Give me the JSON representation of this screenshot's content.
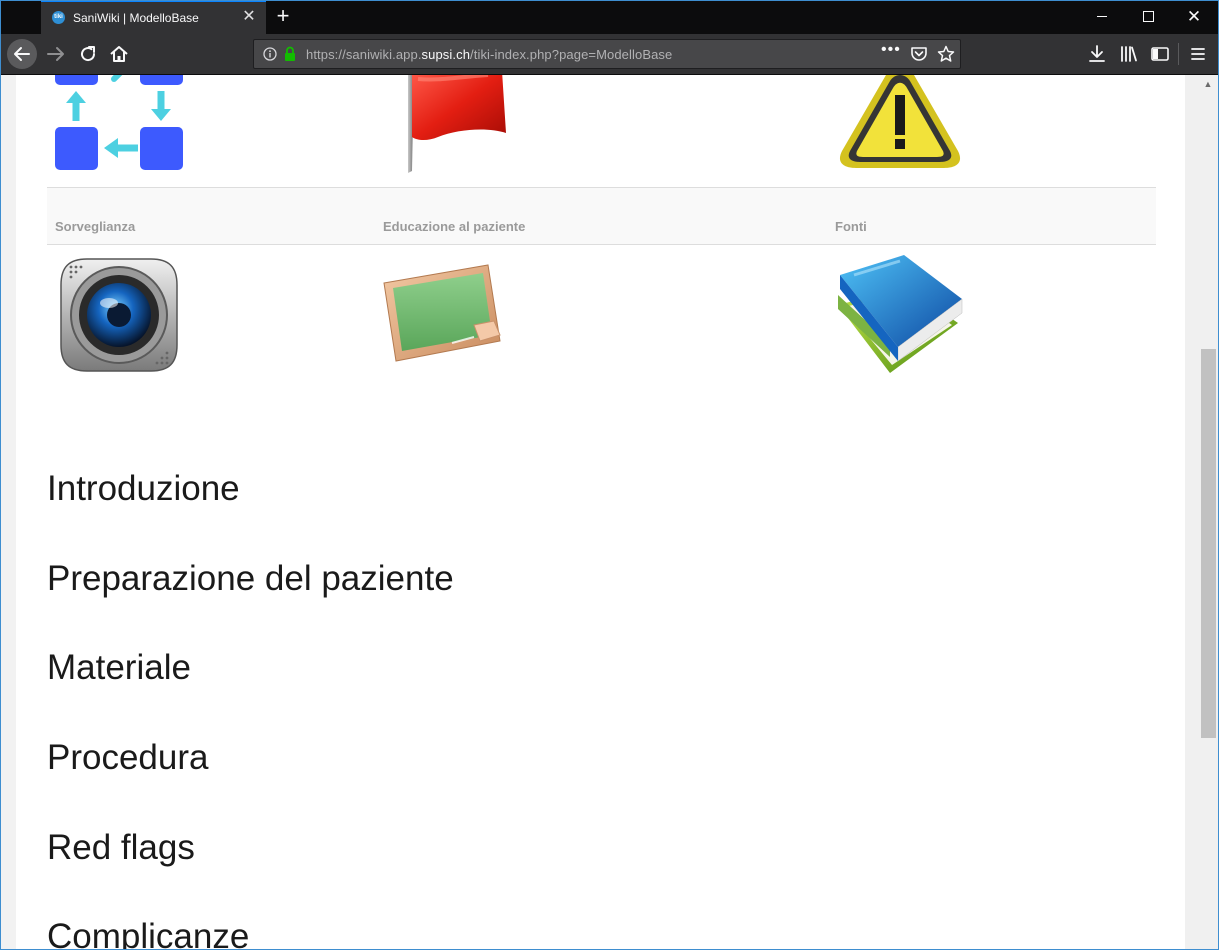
{
  "browser": {
    "tab_title": "SaniWiki | ModelloBase",
    "tab_favicon_text": "tiki",
    "url_prefix": "https://saniwiki.app.",
    "url_host": "supsi.ch",
    "url_path": "/tiki-index.php?page=ModelloBase",
    "url_more": "•••",
    "accent_color": "#0a84ff",
    "icons": {
      "tab_close": "close-icon",
      "new_tab": "plus-icon",
      "back": "arrow-left-icon",
      "forward": "arrow-right-icon",
      "reload": "reload-icon",
      "home": "home-icon",
      "site_info": "info-icon",
      "secure": "lock-icon",
      "pocket": "pocket-icon",
      "bookmark": "star-icon",
      "downloads": "download-icon",
      "library": "library-icon",
      "sidebar": "sidebar-icon",
      "menu": "hamburger-menu-icon"
    }
  },
  "content": {
    "icon_row_1": [
      "process-cycle-icon",
      "red-flag-icon",
      "warning-icon"
    ],
    "labels": [
      "Sorveglianza",
      "Educazione al paziente",
      "Fonti"
    ],
    "icon_row_2": [
      "camera-icon",
      "chalkboard-icon",
      "books-icon"
    ],
    "sections": [
      "Introduzione",
      "Preparazione del paziente",
      "Materiale",
      "Procedura",
      "Red flags",
      "Complicanze"
    ]
  }
}
